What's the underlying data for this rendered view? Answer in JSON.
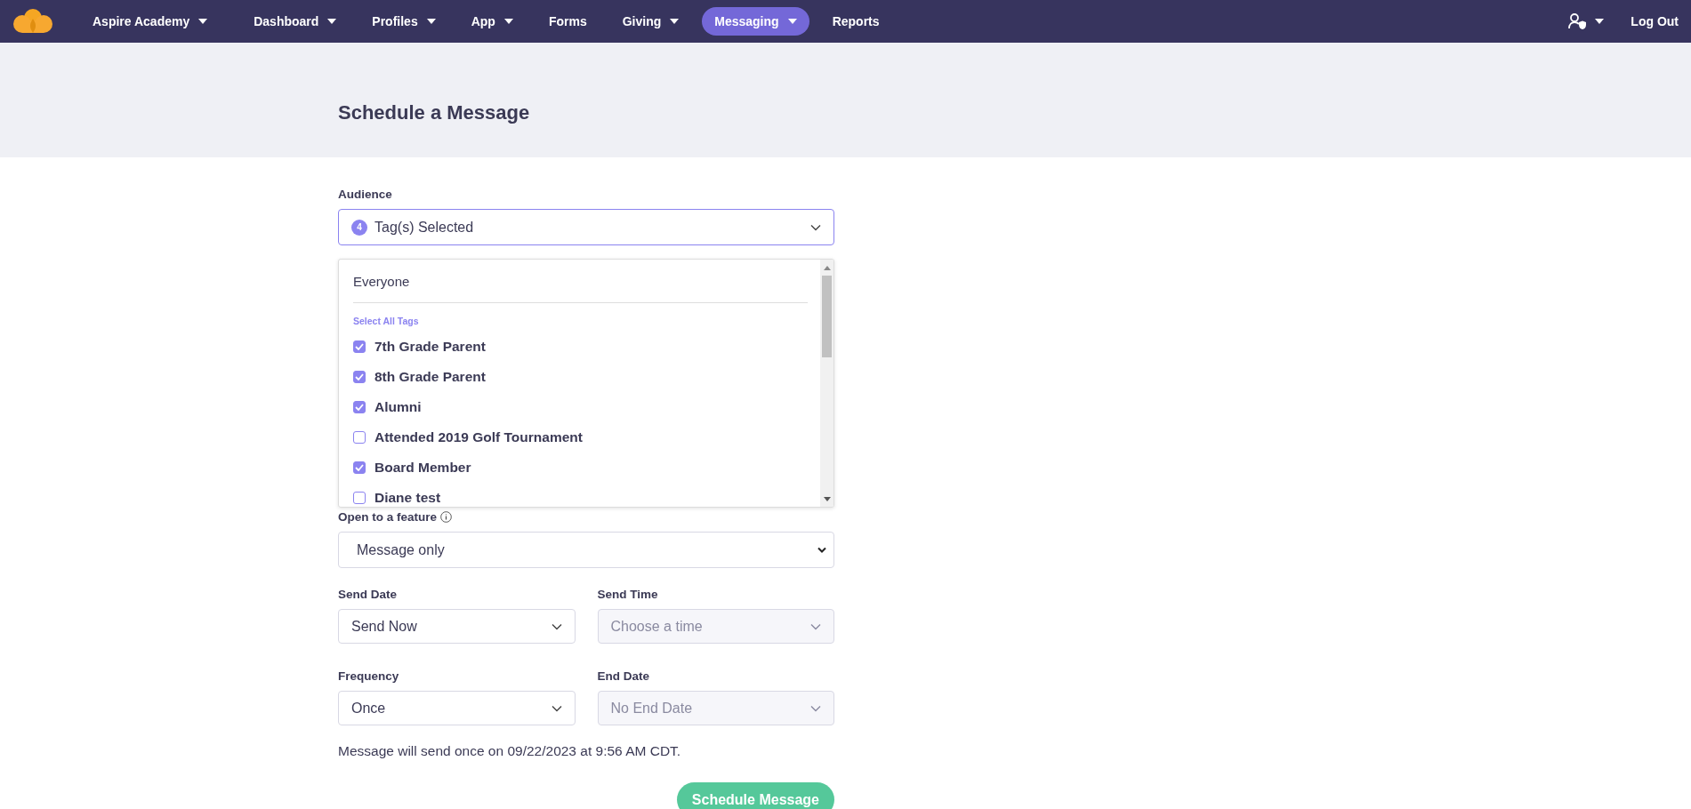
{
  "nav": {
    "brand": "Aspire Academy",
    "items": [
      {
        "label": "Dashboard",
        "dropdown": true,
        "selected": false
      },
      {
        "label": "Profiles",
        "dropdown": true,
        "selected": false
      },
      {
        "label": "App",
        "dropdown": true,
        "selected": false
      },
      {
        "label": "Forms",
        "dropdown": false,
        "selected": false
      },
      {
        "label": "Giving",
        "dropdown": true,
        "selected": false
      },
      {
        "label": "Messaging",
        "dropdown": true,
        "selected": true
      },
      {
        "label": "Reports",
        "dropdown": false,
        "selected": false
      }
    ],
    "logout": "Log Out"
  },
  "page": {
    "title": "Schedule a Message"
  },
  "audience": {
    "label": "Audience",
    "count": "4",
    "value": "Tag(s) Selected",
    "expanded": true,
    "everyone": "Everyone",
    "select_all": "Select All Tags",
    "tags": [
      {
        "label": "7th Grade Parent",
        "checked": true
      },
      {
        "label": "8th Grade Parent",
        "checked": true
      },
      {
        "label": "Alumni",
        "checked": true
      },
      {
        "label": "Attended 2019 Golf Tournament",
        "checked": false
      },
      {
        "label": "Board Member",
        "checked": true
      },
      {
        "label": "Diane test",
        "checked": false
      }
    ]
  },
  "open_feature": {
    "label": "Open to a feature",
    "value": "Message only"
  },
  "rows": [
    [
      {
        "label": "Send Date",
        "value": "Send Now",
        "disabled": false
      },
      {
        "label": "Send Time",
        "placeholder": "Choose a time",
        "disabled": true
      }
    ],
    [
      {
        "label": "Frequency",
        "value": "Once",
        "disabled": false
      },
      {
        "label": "End Date",
        "placeholder": "No End Date",
        "disabled": true
      }
    ]
  ],
  "summary": "Message will send once on 09/22/2023 at 9:56 AM CDT.",
  "submit": "Schedule Message"
}
